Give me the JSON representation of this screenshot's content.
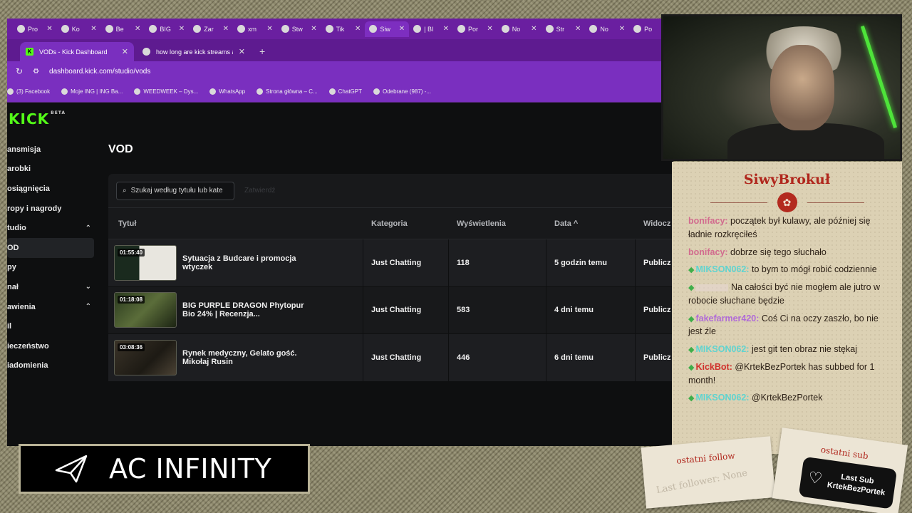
{
  "browser": {
    "top_tabs": [
      {
        "label": "Pro"
      },
      {
        "label": "Ko"
      },
      {
        "label": "Be"
      },
      {
        "label": "BIG"
      },
      {
        "label": "Zar"
      },
      {
        "label": "xm"
      },
      {
        "label": "Stw"
      },
      {
        "label": "Tik"
      },
      {
        "label": "Siw"
      },
      {
        "label": "| BI"
      },
      {
        "label": "Por"
      },
      {
        "label": "No"
      },
      {
        "label": "Str"
      },
      {
        "label": "No"
      },
      {
        "label": "Po"
      }
    ],
    "tabs": [
      {
        "label": "VODs - Kick Dashboard"
      },
      {
        "label": "how long are kick streams av"
      }
    ],
    "address": "dashboard.kick.com/studio/vods",
    "bookmarks": [
      {
        "label": "(3) Facebook"
      },
      {
        "label": "Moje ING | ING Ba..."
      },
      {
        "label": "WEEDWEEK – Dys..."
      },
      {
        "label": "WhatsApp"
      },
      {
        "label": "Strona główna – C..."
      },
      {
        "label": "ChatGPT"
      },
      {
        "label": "Odebrane (987) -..."
      }
    ]
  },
  "dashboard": {
    "logo": "KICK",
    "logo_badge": "BETA",
    "sidebar": [
      {
        "label": "ansmisja",
        "chevron": ""
      },
      {
        "label": "arobki",
        "chevron": ""
      },
      {
        "label": "osiągnięcia",
        "chevron": ""
      },
      {
        "label": "ropy i nagrody",
        "chevron": ""
      },
      {
        "label": "tudio",
        "chevron": "⌃"
      },
      {
        "label": "OD",
        "chevron": ""
      },
      {
        "label": "py",
        "chevron": ""
      },
      {
        "label": "nał",
        "chevron": "⌄"
      },
      {
        "label": "awienia",
        "chevron": "⌃"
      },
      {
        "label": "il",
        "chevron": ""
      },
      {
        "label": "ieczeństwo",
        "chevron": ""
      },
      {
        "label": "iadomienia",
        "chevron": ""
      }
    ],
    "page_title": "VOD",
    "search_placeholder": "Szukaj według tytułu lub kate",
    "confirm_label": "Zatwierdź",
    "columns": {
      "title": "Tytuł",
      "category": "Kategoria",
      "views": "Wyświetlenia",
      "date": "Data ^",
      "visibility": "Widocz"
    },
    "rows": [
      {
        "duration": "01:55:40",
        "title": "Sytuacja z Budcare i promocja wtyczek",
        "category": "Just Chatting",
        "views": "118",
        "date": "5 godzin temu",
        "visibility": "Publicz"
      },
      {
        "duration": "01:18:08",
        "title": "BIG PURPLE DRAGON Phytopur Bio 24% | Recenzja...",
        "category": "Just Chatting",
        "views": "583",
        "date": "4 dni temu",
        "visibility": "Publicz"
      },
      {
        "duration": "03:08:36",
        "title": "Rynek medyczny, Gelato gość. Mikołaj Rusin",
        "category": "Just Chatting",
        "views": "446",
        "date": "6 dni temu",
        "visibility": "Publicz"
      }
    ]
  },
  "banner": {
    "text": "AC INFINITY"
  },
  "chat": {
    "title": "SiwyBrokuł",
    "messages": [
      {
        "nick": "bonifacy:",
        "text": " początek był kulawy, ale później się ładnie rozkręciłeś",
        "color": "#d26b8e",
        "gem": false
      },
      {
        "nick": "bonifacy:",
        "text": " dobrze się tego słuchało",
        "color": "#d26b8e",
        "gem": false
      },
      {
        "nick": "MIKSON062:",
        "text": " to bym to mógł robić codziennie",
        "color": "#5fd4d0",
        "gem": true
      },
      {
        "nick": "",
        "text": " Na całości być nie mogłem ale jutro w robocie słuchane będzie",
        "color": "#e8d8d8",
        "gem": true
      },
      {
        "nick": "fakefarmer420:",
        "text": " Coś Ci na oczy zaszło, bo nie jest źle",
        "color": "#b06ad8",
        "gem": true
      },
      {
        "nick": "MIKSON062:",
        "text": " jest git ten obraz nie stękaj",
        "color": "#5fd4d0",
        "gem": true
      },
      {
        "nick": "KickBot:",
        "text": " @KrtekBezPortek has subbed for 1 month!",
        "color": "#d0302b",
        "gem": true
      },
      {
        "nick": "MIKSON062:",
        "text": " @KrtekBezPortek",
        "color": "#5fd4d0",
        "gem": true
      }
    ]
  },
  "follow_card": {
    "label": "ostatni follow",
    "value": "Last follower: None"
  },
  "sub_card": {
    "label": "ostatni sub",
    "line1": "Last Sub",
    "line2": "KrtekBezPortek"
  },
  "colors": {
    "kick_green": "#53fc18",
    "browser_purple": "#7a2fbf",
    "chat_title": "#b0261c"
  }
}
